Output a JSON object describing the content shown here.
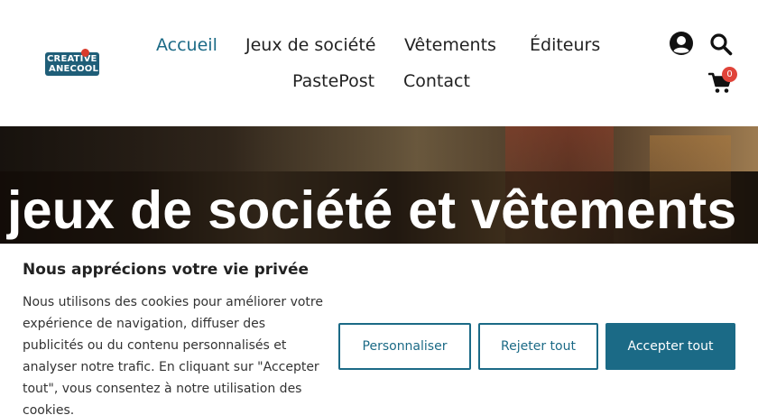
{
  "brand": {
    "logo_line1": "CREATIVE",
    "logo_line2": "ANECOOL"
  },
  "nav": {
    "items": [
      {
        "label": "Accueil",
        "active": true
      },
      {
        "label": "Jeux de société",
        "active": false
      },
      {
        "label": "Vêtements",
        "active": false
      },
      {
        "label": "Éditeurs",
        "active": false
      },
      {
        "label": "PastePost",
        "active": false
      },
      {
        "label": "Contact",
        "active": false
      }
    ]
  },
  "header_icons": {
    "account": "user-circle-icon",
    "search": "search-icon",
    "cart": "shopping-cart-icon",
    "cart_count": "0"
  },
  "hero": {
    "title": "jeux de société et vêtements"
  },
  "cookie_banner": {
    "title": "Nous apprécions votre vie privée",
    "text": "Nous utilisons des cookies pour améliorer votre expérience de navigation, diffuser des publicités ou du contenu personnalisés et analyser notre trafic. En cliquant sur \"Accepter tout\", vous consentez à notre utilisation des cookies.",
    "buttons": {
      "customize": "Personnaliser",
      "reject": "Rejeter tout",
      "accept": "Accepter tout"
    }
  },
  "colors": {
    "accent": "#1b6a86",
    "badge": "#e0443a",
    "text": "#222222"
  }
}
